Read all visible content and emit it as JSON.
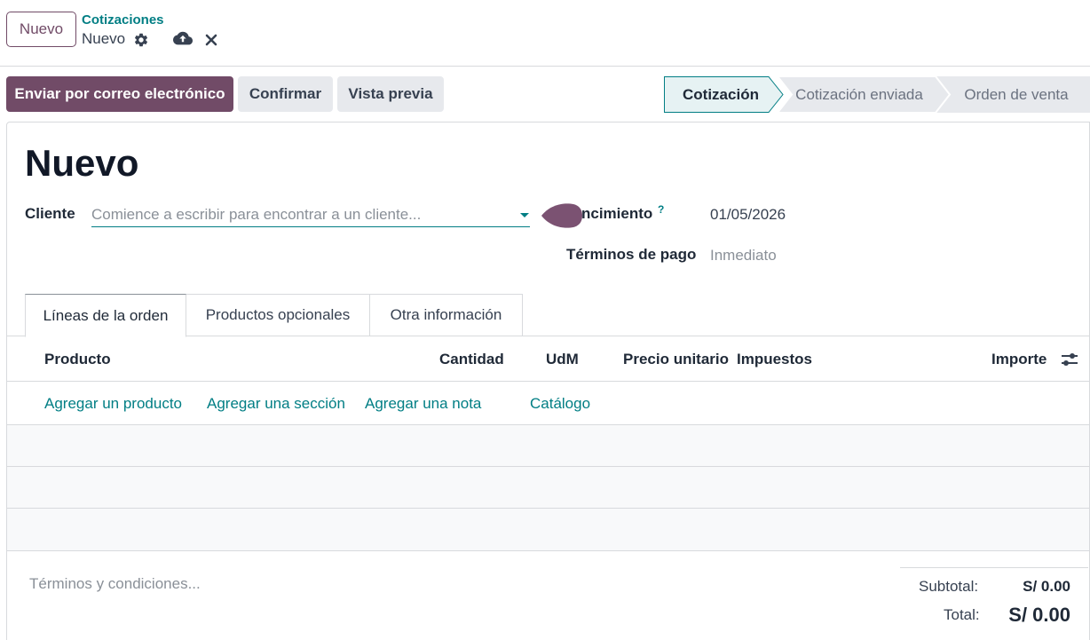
{
  "control_panel": {
    "new_button_label": "Nuevo",
    "breadcrumb": "Cotizaciones",
    "record_name": "Nuevo",
    "icons": [
      "gear-icon",
      "cloud-upload-icon",
      "close-icon"
    ]
  },
  "actions": {
    "send_email_label": "Enviar por correo electrónico",
    "confirm_label": "Confirmar",
    "preview_label": "Vista previa"
  },
  "statusbar": {
    "stages": [
      "Cotización",
      "Cotización enviada",
      "Orden de venta"
    ],
    "active_index": 0
  },
  "form": {
    "title": "Nuevo",
    "client_label": "Cliente",
    "client_placeholder": "Comience a escribir para encontrar a un cliente...",
    "expiry_label": "ncimiento",
    "expiry_help": "?",
    "expiry_value": "01/05/2026",
    "payment_terms_label": "Términos de pago",
    "payment_terms_value": "Inmediato"
  },
  "tabs": [
    "Líneas de la orden",
    "Productos opcionales",
    "Otra información"
  ],
  "order_lines": {
    "columns": [
      "Producto",
      "Cantidad",
      "UdM",
      "Precio unitario",
      "Impuestos",
      "Importe"
    ],
    "add_links": [
      "Agregar un producto",
      "Agregar una sección",
      "Agregar una nota",
      "Catálogo"
    ]
  },
  "footer": {
    "terms_placeholder": "Términos y condiciones...",
    "subtotal_label": "Subtotal:",
    "subtotal_value": "S/ 0.00",
    "total_label": "Total:",
    "total_value": "S/ 0.00"
  },
  "colors": {
    "primary": "#714b67",
    "link": "#017e84",
    "status_active_bg": "#e6f2f3",
    "status_inactive_bg": "#e7e9ed"
  }
}
